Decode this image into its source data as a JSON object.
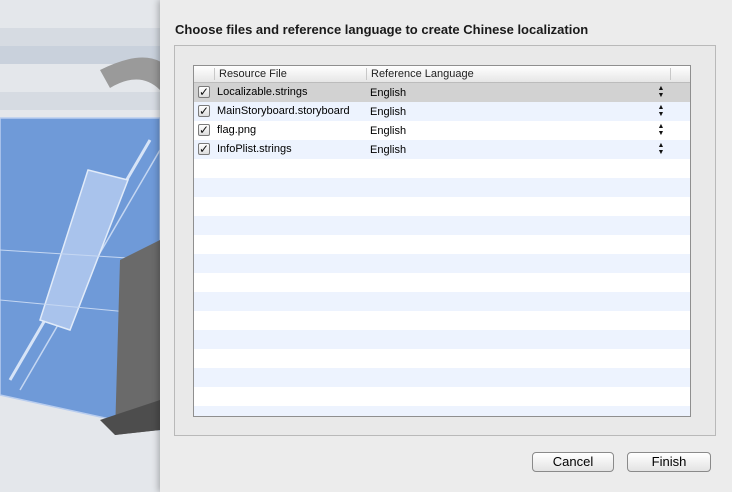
{
  "sheet": {
    "title": "Choose files and reference language to create Chinese localization"
  },
  "table": {
    "columns": [
      "Resource File",
      "Reference Language"
    ],
    "rows": [
      {
        "file": "Localizable.strings",
        "language": "English",
        "checked": true,
        "selected": true
      },
      {
        "file": "MainStoryboard.storyboard",
        "language": "English",
        "checked": true,
        "selected": false
      },
      {
        "file": "flag.png",
        "language": "English",
        "checked": true,
        "selected": false
      },
      {
        "file": "InfoPlist.strings",
        "language": "English",
        "checked": true,
        "selected": false
      }
    ]
  },
  "buttons": {
    "cancel": "Cancel",
    "finish": "Finish"
  },
  "icons": {
    "checkbox": "checkmark-icon",
    "updown": "up-down-arrows-icon"
  }
}
